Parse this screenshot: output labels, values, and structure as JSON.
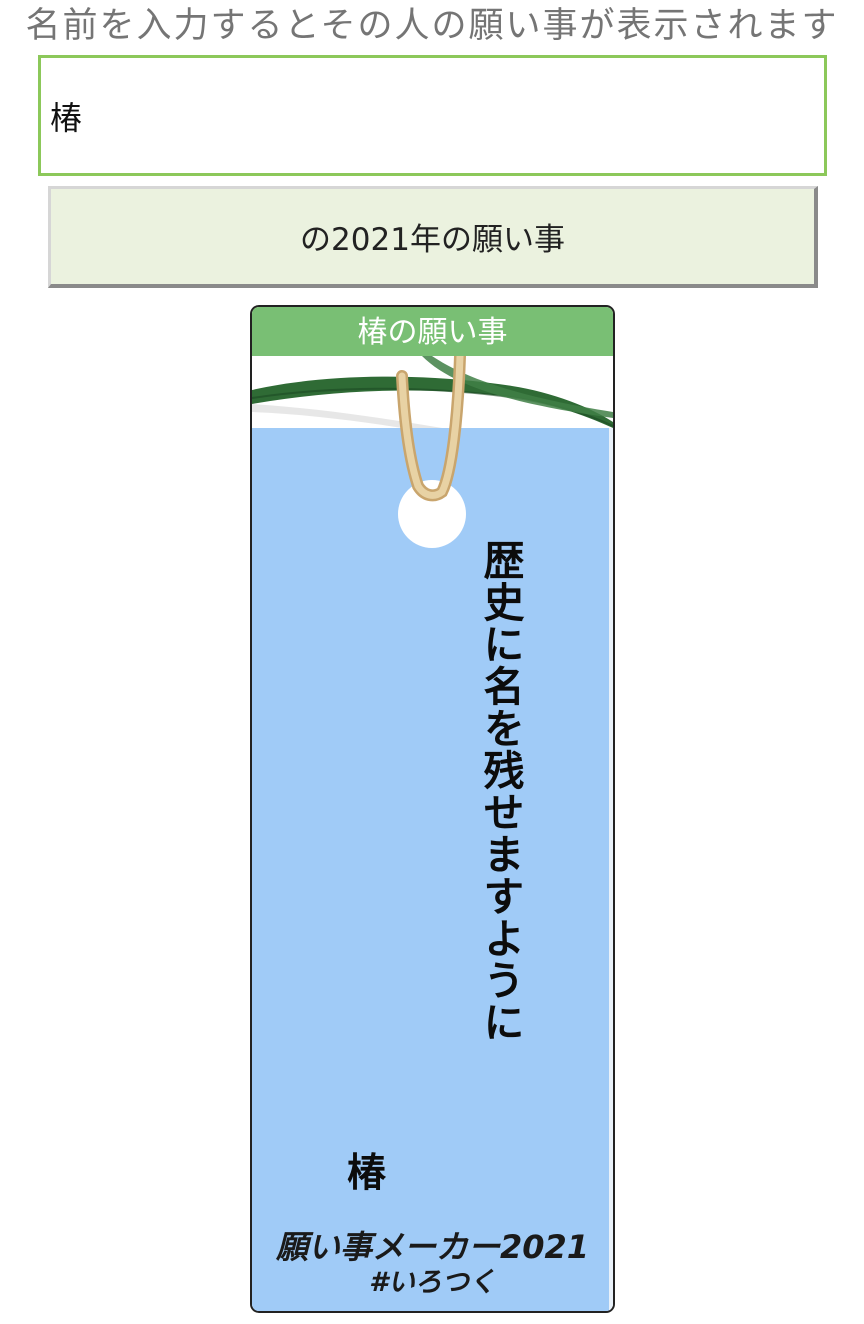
{
  "instruction": "名前を入力するとその人の願い事が表示されます",
  "input": {
    "value": "椿"
  },
  "button": {
    "label": "の2021年の願い事"
  },
  "card": {
    "header": "椿の願い事",
    "wish": "歴史に名を残せますように",
    "name": "椿",
    "footer_title": "願い事メーカー2021",
    "footer_tag": "#いろつく"
  },
  "colors": {
    "input_border": "#8cc85a",
    "button_bg": "#ebf2df",
    "header_bg": "#79bf74",
    "strip_bg": "#a0cbf7",
    "bamboo": "#2f6b35"
  },
  "icons": {
    "bamboo": "bamboo-leaf-icon",
    "hole": "string-hole-icon"
  }
}
